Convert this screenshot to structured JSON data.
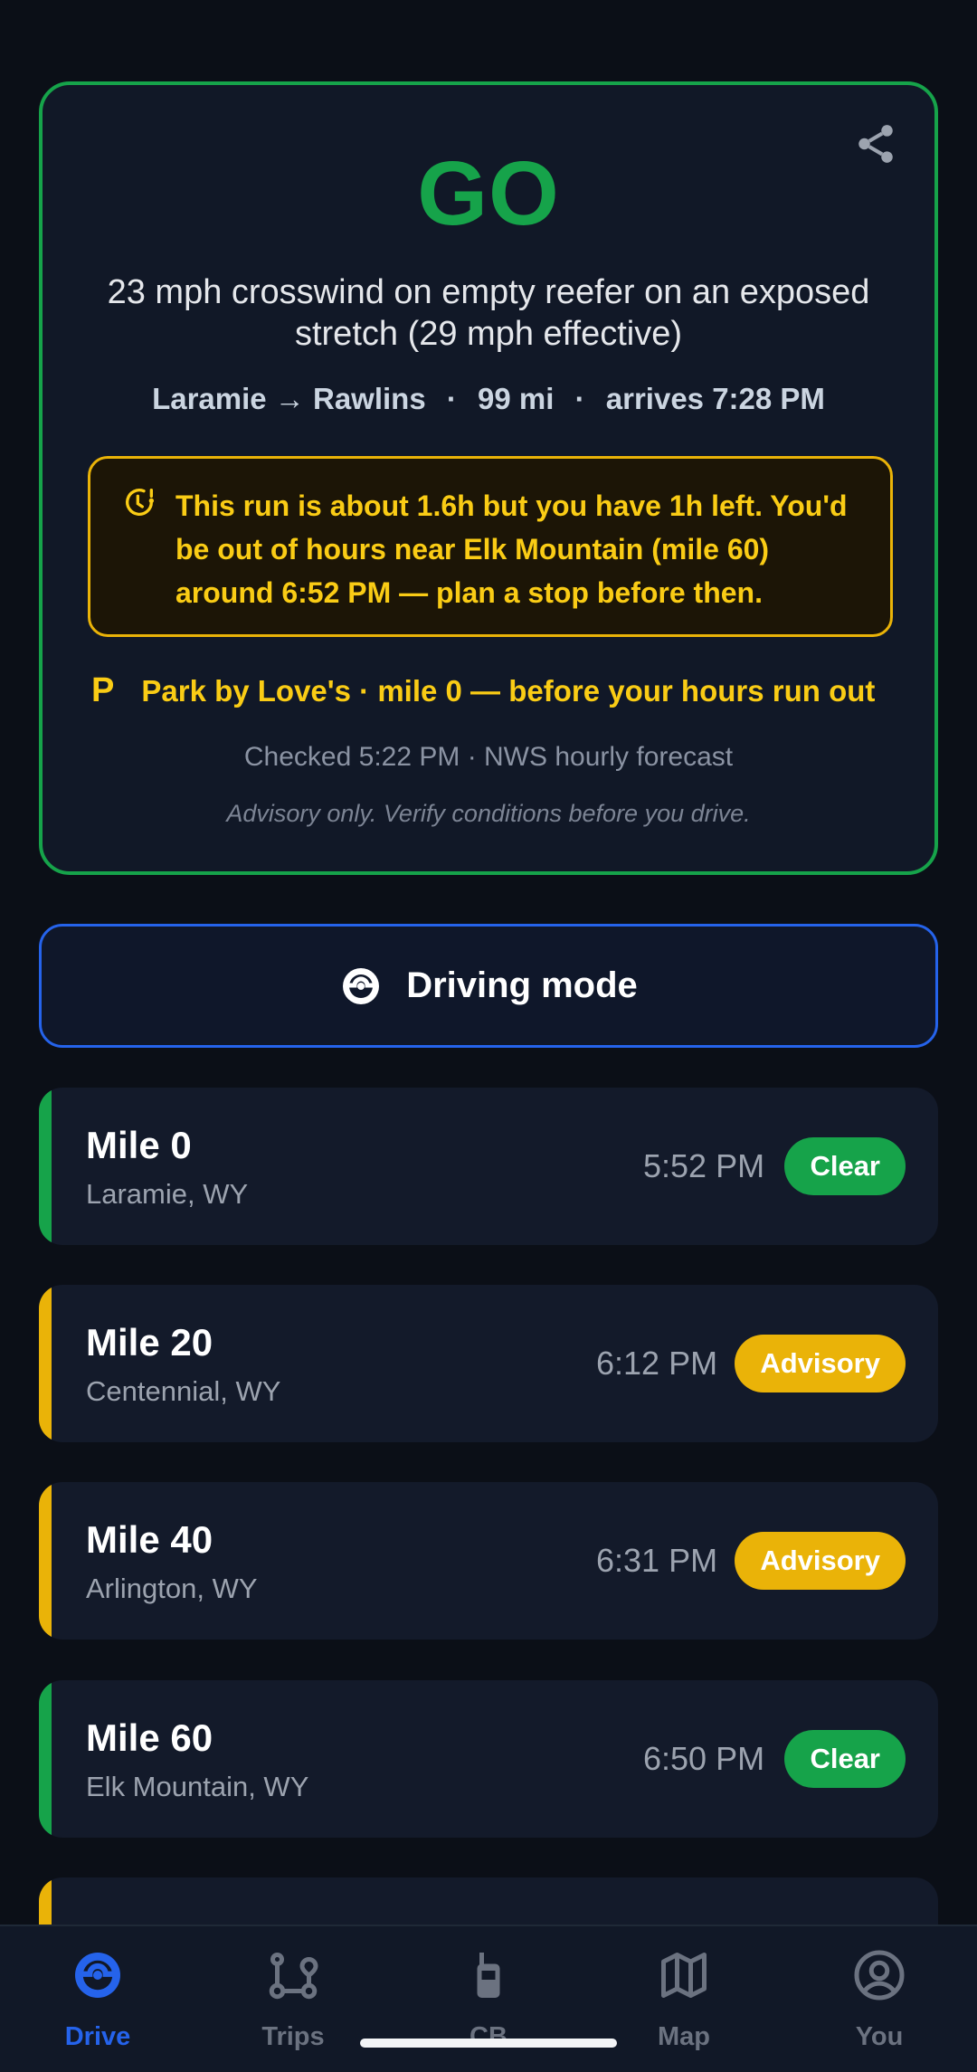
{
  "verdict_card": {
    "verdict": "GO",
    "reason": "23 mph crosswind on empty reefer on an exposed stretch (29 mph effective)",
    "route": {
      "from": "Laramie",
      "arrow": "→",
      "to": "Rawlins",
      "distance": "99 mi",
      "arrival": "arrives 7:28 PM",
      "separator": "·"
    },
    "hours_warning": "This run is about 1.6h but you have 1h left. You'd be out of hours near Elk Mountain (mile 60) around 6:52 PM — plan a stop before then.",
    "park": {
      "icon_letter": "P",
      "text": "Park by Love's · mile 0 — before your hours run out"
    },
    "checked": "Checked 5:22 PM · NWS hourly forecast",
    "advisory": "Advisory only. Verify conditions before you drive.",
    "colors": {
      "go": "#16a34a",
      "warning": "#facc15"
    }
  },
  "driving_mode": {
    "label": "Driving mode",
    "icon": "steering-wheel-icon"
  },
  "miles": [
    {
      "mile": "Mile 0",
      "place": "Laramie, WY",
      "time": "5:52 PM",
      "status": "Clear",
      "color": "#16a34a"
    },
    {
      "mile": "Mile 20",
      "place": "Centennial, WY",
      "time": "6:12 PM",
      "status": "Advisory",
      "color": "#eab308"
    },
    {
      "mile": "Mile 40",
      "place": "Arlington, WY",
      "time": "6:31 PM",
      "status": "Advisory",
      "color": "#eab308"
    },
    {
      "mile": "Mile 60",
      "place": "Elk Mountain, WY",
      "time": "6:50 PM",
      "status": "Clear",
      "color": "#16a34a"
    },
    {
      "mile": "",
      "place": "",
      "time": "",
      "status": "",
      "color": "#eab308"
    }
  ],
  "nav": [
    {
      "label": "Drive",
      "icon": "steering-wheel-icon",
      "active": true
    },
    {
      "label": "Trips",
      "icon": "route-icon",
      "active": false
    },
    {
      "label": "CB",
      "icon": "radio-icon",
      "active": false
    },
    {
      "label": "Map",
      "icon": "map-icon",
      "active": false
    },
    {
      "label": "You",
      "icon": "user-icon",
      "active": false
    }
  ]
}
